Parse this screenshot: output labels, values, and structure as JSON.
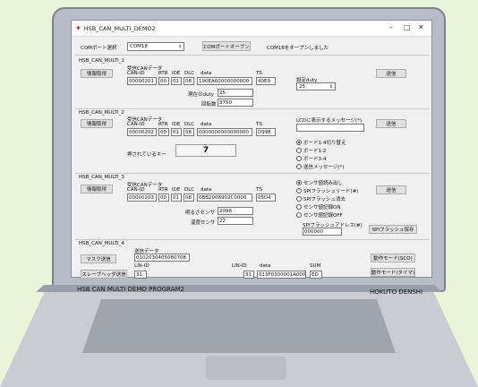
{
  "window": {
    "title": "HSB_CAN_MULTI_DEMO2"
  },
  "top": {
    "port_label": "COMポート選択",
    "port_value": "COM18",
    "open_button": "COMポートオープン",
    "status": "COM18をオープンしました"
  },
  "m1": {
    "group": "HSB_CAN_MULTI_1",
    "info_button": "情報取得",
    "recv_label": "受信CANデータ",
    "h_can": "CAN-ID",
    "h_rtr": "RTR",
    "h_ide": "IDE",
    "h_dlc": "DLC",
    "h_data": "data",
    "h_ts": "TS",
    "can": "00000201",
    "rtr": "00",
    "ide": "01",
    "dlc": "08",
    "data": "190EA60000000000",
    "ts": "40E9",
    "setting_label": "設定duty",
    "setting_value": "25",
    "send_button": "送信",
    "duty_label": "現在のduty",
    "duty_value": "25",
    "rpm_label": "回転数",
    "rpm_value": "3750"
  },
  "m2": {
    "group": "HSB_CAN_MULTI_2",
    "info_button": "情報取得",
    "recv_label": "受信CANデータ",
    "h_can": "CAN-ID",
    "h_rtr": "RTR",
    "h_ide": "IDE",
    "h_dlc": "DLC",
    "h_data": "data",
    "h_ts": "TS",
    "can": "00000202",
    "rtr": "00",
    "ide": "01",
    "dlc": "08",
    "data": "0000000000000000",
    "ts": "D99E",
    "lcd_label": "LCDに表示するメッセージ(*)",
    "lcd_value": "",
    "send_button": "送信",
    "key_label": "押されているキー",
    "key_value": "7",
    "radios": [
      "ボード1-4切り替え",
      "ボード1-2",
      "ボード3-4",
      "送信メッセージ(*)"
    ]
  },
  "m3": {
    "group": "HSB_CAN_MULTI_3",
    "info_button": "情報取得",
    "recv_label": "受信CANデータ",
    "h_can": "CAN-ID",
    "h_rtr": "RTR",
    "h_ide": "IDE",
    "h_dlc": "DLC",
    "h_data": "data",
    "h_ts": "TS",
    "can": "00000203",
    "rtr": "00",
    "ide": "01",
    "dlc": "08",
    "data": "0BB2008902C0000",
    "ts": "05D4",
    "light_label": "明るさセンサ",
    "light_value": "2098",
    "temp_label": "温度センサ",
    "temp_value": "22",
    "radios": [
      "センサ値読み出し",
      "SPIフラッシュリード(#)",
      "SPIフラッシュ消去",
      "センサ値記録ON",
      "センサ値記録OFF"
    ],
    "send_button": "送信",
    "spi_addr_label": "SPIフラッシュアドレス(#)",
    "spi_addr_value": "000000",
    "spi_save_button": "SPIフラッシュ保存"
  },
  "m4": {
    "group": "HSB_CAN_MULTI_4",
    "mask_button": "マスク送信",
    "send_label": "送信データ",
    "send_value": "0102030405060708",
    "lin_label": "LIN-ID",
    "lin_value": "31",
    "slave_button": "スレーブヘッダ送信",
    "lin_id_label2": "LIN-ID",
    "h_data": "data",
    "h_sum": "SUM",
    "lin_id2": "31",
    "lin_data": "013F0300001A0000",
    "lin_sum": "ED",
    "mode_button1": "動作モード(SCO)",
    "mode_button2": "動作モード(タイマ)"
  },
  "footer": {
    "left": "HSB CAN MULTI DEMO PROGRAM2",
    "right": "HOKUTO DENSHI"
  }
}
